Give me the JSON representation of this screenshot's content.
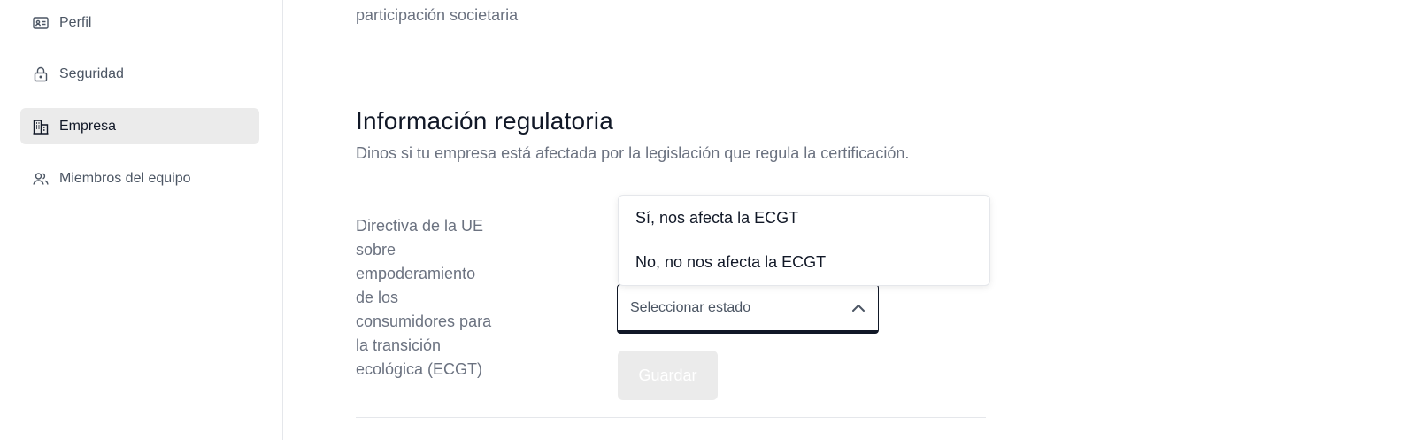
{
  "sidebar": {
    "items": [
      {
        "label": "Perfil",
        "icon": "id-card-icon",
        "active": false
      },
      {
        "label": "Seguridad",
        "icon": "lock-icon",
        "active": false
      },
      {
        "label": "Empresa",
        "icon": "building-icon",
        "active": true
      },
      {
        "label": "Miembros del equipo",
        "icon": "users-icon",
        "active": false
      }
    ]
  },
  "main": {
    "previous_field_label": "participación societaria",
    "section": {
      "title": "Información regulatoria",
      "description": "Dinos si tu empresa está afectada por la legislación que regula la certificación."
    },
    "field": {
      "label": "Directiva de la UE sobre empoderamiento de los consumidores para la transición ecológica (ECGT)",
      "select_placeholder": "Seleccionar estado",
      "select_open": true,
      "options": [
        "Sí, nos afecta la ECGT",
        "No, no nos afecta la ECGT"
      ]
    },
    "save_label": "Guardar"
  },
  "colors": {
    "active_nav_bg": "#ebebeb",
    "muted_text": "#6b7280",
    "border": "#e5e7eb",
    "disabled_button_bg": "#ebebeb"
  }
}
